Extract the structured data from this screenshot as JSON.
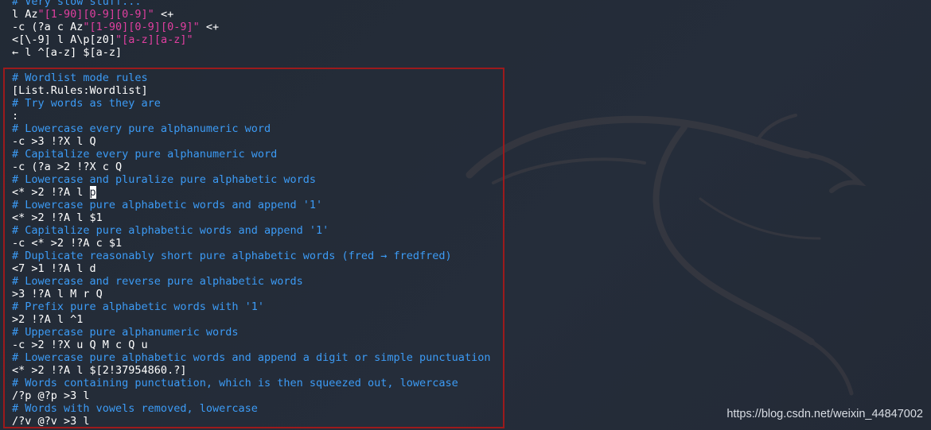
{
  "lines": [
    [
      {
        "t": "# Very slow stuff...",
        "c": "comment"
      }
    ],
    [
      {
        "t": "l Az",
        "c": "white"
      },
      {
        "t": "\"[1-90][0-9][0-9]\"",
        "c": "pink"
      },
      {
        "t": " <+",
        "c": "white"
      }
    ],
    [
      {
        "t": "-c (?a c Az",
        "c": "white"
      },
      {
        "t": "\"[1-90][0-9][0-9]\"",
        "c": "pink"
      },
      {
        "t": " <+",
        "c": "white"
      }
    ],
    [
      {
        "t": "<[\\-9] l A\\p[z0]",
        "c": "white"
      },
      {
        "t": "\"[a-z][a-z]\"",
        "c": "pink"
      }
    ],
    [
      {
        "t": "← l ^[a-z] $[a-z]",
        "c": "white"
      }
    ],
    [
      {
        "t": "",
        "c": "white"
      }
    ],
    [
      {
        "t": "# Wordlist mode rules",
        "c": "comment"
      }
    ],
    [
      {
        "t": "[List.Rules:Wordlist]",
        "c": "white"
      }
    ],
    [
      {
        "t": "# Try words as they are",
        "c": "comment"
      }
    ],
    [
      {
        "t": ":",
        "c": "white"
      }
    ],
    [
      {
        "t": "# Lowercase every pure alphanumeric word",
        "c": "comment"
      }
    ],
    [
      {
        "t": "-c >3 !?X l Q",
        "c": "white"
      }
    ],
    [
      {
        "t": "# Capitalize every pure alphanumeric word",
        "c": "comment"
      }
    ],
    [
      {
        "t": "-c (?a >2 !?X c Q",
        "c": "white"
      }
    ],
    [
      {
        "t": "# Lowercase and pluralize pure alphabetic words",
        "c": "comment"
      }
    ],
    [
      {
        "t": "<* >2 !?A l ",
        "c": "white"
      },
      {
        "t": "p",
        "c": "cursor"
      }
    ],
    [
      {
        "t": "# Lowercase pure alphabetic words and append '1'",
        "c": "comment"
      }
    ],
    [
      {
        "t": "<* >2 !?A l $1",
        "c": "white"
      }
    ],
    [
      {
        "t": "# Capitalize pure alphabetic words and append '1'",
        "c": "comment"
      }
    ],
    [
      {
        "t": "-c <* >2 !?A c $1",
        "c": "white"
      }
    ],
    [
      {
        "t": "# Duplicate reasonably short pure alphabetic words (fred → fredfred)",
        "c": "comment"
      }
    ],
    [
      {
        "t": "<7 >1 !?A l d",
        "c": "white"
      }
    ],
    [
      {
        "t": "# Lowercase and reverse pure alphabetic words",
        "c": "comment"
      }
    ],
    [
      {
        "t": ">3 !?A l M r Q",
        "c": "white"
      }
    ],
    [
      {
        "t": "# Prefix pure alphabetic words with '1'",
        "c": "comment"
      }
    ],
    [
      {
        "t": ">2 !?A l ^1",
        "c": "white"
      }
    ],
    [
      {
        "t": "# Uppercase pure alphanumeric words",
        "c": "comment"
      }
    ],
    [
      {
        "t": "-c >2 !?X u Q M c Q u",
        "c": "white"
      }
    ],
    [
      {
        "t": "# Lowercase pure alphabetic words and append a digit or simple punctuation",
        "c": "comment"
      }
    ],
    [
      {
        "t": "<* >2 !?A l $[2!37954860.?]",
        "c": "white"
      }
    ],
    [
      {
        "t": "# Words containing punctuation, which is then squeezed out, lowercase",
        "c": "comment"
      }
    ],
    [
      {
        "t": "/?p @?p >3 l",
        "c": "white"
      }
    ],
    [
      {
        "t": "# Words with vowels removed, lowercase",
        "c": "comment"
      }
    ],
    [
      {
        "t": "/?v @?v >3 l",
        "c": "white"
      }
    ]
  ],
  "watermark": "https://blog.csdn.net/weixin_44847002",
  "colors": {
    "background": "#232a36",
    "comment": "#3c9bf5",
    "string": "#e03fa0",
    "text": "#ffffff",
    "highlight_border": "#9c1a1c"
  },
  "background_art": "kali-dragon-logo"
}
